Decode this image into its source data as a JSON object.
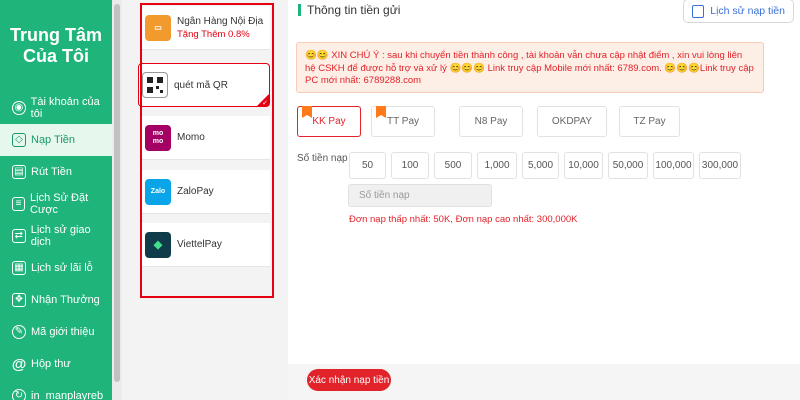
{
  "sidebar": {
    "brand_line1": "Trung Tâm",
    "brand_line2": "Của Tôi",
    "items": [
      {
        "label": "Tài khoản của tôi",
        "icon": "user-circle-icon"
      },
      {
        "label": "Nạp Tiền",
        "icon": "wallet-icon",
        "active": true
      },
      {
        "label": "Rút Tiền",
        "icon": "withdraw-icon"
      },
      {
        "label": "Lịch Sử Đặt Cược",
        "icon": "document-icon"
      },
      {
        "label": "Lịch sử giao dịch",
        "icon": "transaction-icon"
      },
      {
        "label": "Lịch sử lãi lỗ",
        "icon": "profit-loss-icon"
      },
      {
        "label": "Nhận Thưởng",
        "icon": "gift-icon"
      },
      {
        "label": "Mã giới thiệu",
        "icon": "referral-icon"
      },
      {
        "label": "Hộp thư",
        "icon": "at-mail-icon"
      },
      {
        "label": "in_manplayreb",
        "icon": "username-icon"
      }
    ]
  },
  "methods": [
    {
      "label": "Ngân Hàng Nội Địa",
      "sub": "Tặng Thêm 0.8%",
      "icon": "bank-card-icon",
      "color": "#f39a2e"
    },
    {
      "label": "quét mã QR",
      "icon": "qr-code-icon",
      "color": "#222222",
      "selected": true
    },
    {
      "label": "Momo",
      "icon": "momo-logo-icon",
      "color": "#a50064"
    },
    {
      "label": "ZaloPay",
      "icon": "zalopay-logo-icon",
      "color": "#0aa4e8"
    },
    {
      "label": "ViettelPay",
      "icon": "viettelpay-logo-icon",
      "color": "#0f3b4a"
    }
  ],
  "main": {
    "title": "Thông tin tiền gửi",
    "history_button": "Lịch sử nạp tiền",
    "notice": "😊😊 XIN CHÚ Ý : sau khi chuyển tiền thành công , tài khoản vẫn chưa cập nhật điểm , xin vui lòng liên hệ CSKH để được hỗ trợ và xử lý 😊😊😊 Link truy cập Mobile mới nhất: 6789.com. 😊😊😊Link truy cập PC mới nhất: 6789288.com",
    "tabs": [
      {
        "label": "KK Pay",
        "active": true,
        "flag": true
      },
      {
        "label": "TT Pay",
        "flag": true
      },
      {
        "label": "N8 Pay"
      },
      {
        "label": "OKDPAY"
      },
      {
        "label": "TZ Pay"
      }
    ],
    "amount_label": "Số tiền nạp :",
    "amounts": [
      "50",
      "100",
      "500",
      "1,000",
      "5,000",
      "10,000",
      "50,000",
      "100,000",
      "300,000"
    ],
    "amount_placeholder": "Số tiền nạp",
    "limits": "Đơn nạp thấp nhất:  50K,  Đơn nạp cao nhất:  300,000K",
    "confirm_button": "Xác nhận nạp tiền"
  },
  "colors": {
    "primary": "#1fb47a",
    "accent": "#e2232a"
  }
}
